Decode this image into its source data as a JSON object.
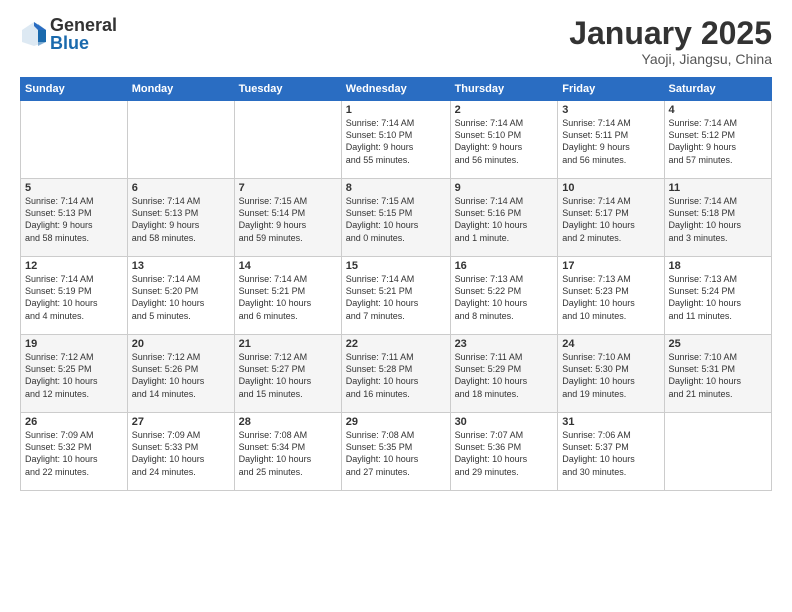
{
  "logo": {
    "general": "General",
    "blue": "Blue"
  },
  "title": "January 2025",
  "subtitle": "Yaoji, Jiangsu, China",
  "days_header": [
    "Sunday",
    "Monday",
    "Tuesday",
    "Wednesday",
    "Thursday",
    "Friday",
    "Saturday"
  ],
  "weeks": [
    [
      {
        "day": "",
        "info": ""
      },
      {
        "day": "",
        "info": ""
      },
      {
        "day": "",
        "info": ""
      },
      {
        "day": "1",
        "info": "Sunrise: 7:14 AM\nSunset: 5:10 PM\nDaylight: 9 hours\nand 55 minutes."
      },
      {
        "day": "2",
        "info": "Sunrise: 7:14 AM\nSunset: 5:10 PM\nDaylight: 9 hours\nand 56 minutes."
      },
      {
        "day": "3",
        "info": "Sunrise: 7:14 AM\nSunset: 5:11 PM\nDaylight: 9 hours\nand 56 minutes."
      },
      {
        "day": "4",
        "info": "Sunrise: 7:14 AM\nSunset: 5:12 PM\nDaylight: 9 hours\nand 57 minutes."
      }
    ],
    [
      {
        "day": "5",
        "info": "Sunrise: 7:14 AM\nSunset: 5:13 PM\nDaylight: 9 hours\nand 58 minutes."
      },
      {
        "day": "6",
        "info": "Sunrise: 7:14 AM\nSunset: 5:13 PM\nDaylight: 9 hours\nand 58 minutes."
      },
      {
        "day": "7",
        "info": "Sunrise: 7:15 AM\nSunset: 5:14 PM\nDaylight: 9 hours\nand 59 minutes."
      },
      {
        "day": "8",
        "info": "Sunrise: 7:15 AM\nSunset: 5:15 PM\nDaylight: 10 hours\nand 0 minutes."
      },
      {
        "day": "9",
        "info": "Sunrise: 7:14 AM\nSunset: 5:16 PM\nDaylight: 10 hours\nand 1 minute."
      },
      {
        "day": "10",
        "info": "Sunrise: 7:14 AM\nSunset: 5:17 PM\nDaylight: 10 hours\nand 2 minutes."
      },
      {
        "day": "11",
        "info": "Sunrise: 7:14 AM\nSunset: 5:18 PM\nDaylight: 10 hours\nand 3 minutes."
      }
    ],
    [
      {
        "day": "12",
        "info": "Sunrise: 7:14 AM\nSunset: 5:19 PM\nDaylight: 10 hours\nand 4 minutes."
      },
      {
        "day": "13",
        "info": "Sunrise: 7:14 AM\nSunset: 5:20 PM\nDaylight: 10 hours\nand 5 minutes."
      },
      {
        "day": "14",
        "info": "Sunrise: 7:14 AM\nSunset: 5:21 PM\nDaylight: 10 hours\nand 6 minutes."
      },
      {
        "day": "15",
        "info": "Sunrise: 7:14 AM\nSunset: 5:21 PM\nDaylight: 10 hours\nand 7 minutes."
      },
      {
        "day": "16",
        "info": "Sunrise: 7:13 AM\nSunset: 5:22 PM\nDaylight: 10 hours\nand 8 minutes."
      },
      {
        "day": "17",
        "info": "Sunrise: 7:13 AM\nSunset: 5:23 PM\nDaylight: 10 hours\nand 10 minutes."
      },
      {
        "day": "18",
        "info": "Sunrise: 7:13 AM\nSunset: 5:24 PM\nDaylight: 10 hours\nand 11 minutes."
      }
    ],
    [
      {
        "day": "19",
        "info": "Sunrise: 7:12 AM\nSunset: 5:25 PM\nDaylight: 10 hours\nand 12 minutes."
      },
      {
        "day": "20",
        "info": "Sunrise: 7:12 AM\nSunset: 5:26 PM\nDaylight: 10 hours\nand 14 minutes."
      },
      {
        "day": "21",
        "info": "Sunrise: 7:12 AM\nSunset: 5:27 PM\nDaylight: 10 hours\nand 15 minutes."
      },
      {
        "day": "22",
        "info": "Sunrise: 7:11 AM\nSunset: 5:28 PM\nDaylight: 10 hours\nand 16 minutes."
      },
      {
        "day": "23",
        "info": "Sunrise: 7:11 AM\nSunset: 5:29 PM\nDaylight: 10 hours\nand 18 minutes."
      },
      {
        "day": "24",
        "info": "Sunrise: 7:10 AM\nSunset: 5:30 PM\nDaylight: 10 hours\nand 19 minutes."
      },
      {
        "day": "25",
        "info": "Sunrise: 7:10 AM\nSunset: 5:31 PM\nDaylight: 10 hours\nand 21 minutes."
      }
    ],
    [
      {
        "day": "26",
        "info": "Sunrise: 7:09 AM\nSunset: 5:32 PM\nDaylight: 10 hours\nand 22 minutes."
      },
      {
        "day": "27",
        "info": "Sunrise: 7:09 AM\nSunset: 5:33 PM\nDaylight: 10 hours\nand 24 minutes."
      },
      {
        "day": "28",
        "info": "Sunrise: 7:08 AM\nSunset: 5:34 PM\nDaylight: 10 hours\nand 25 minutes."
      },
      {
        "day": "29",
        "info": "Sunrise: 7:08 AM\nSunset: 5:35 PM\nDaylight: 10 hours\nand 27 minutes."
      },
      {
        "day": "30",
        "info": "Sunrise: 7:07 AM\nSunset: 5:36 PM\nDaylight: 10 hours\nand 29 minutes."
      },
      {
        "day": "31",
        "info": "Sunrise: 7:06 AM\nSunset: 5:37 PM\nDaylight: 10 hours\nand 30 minutes."
      },
      {
        "day": "",
        "info": ""
      }
    ]
  ]
}
